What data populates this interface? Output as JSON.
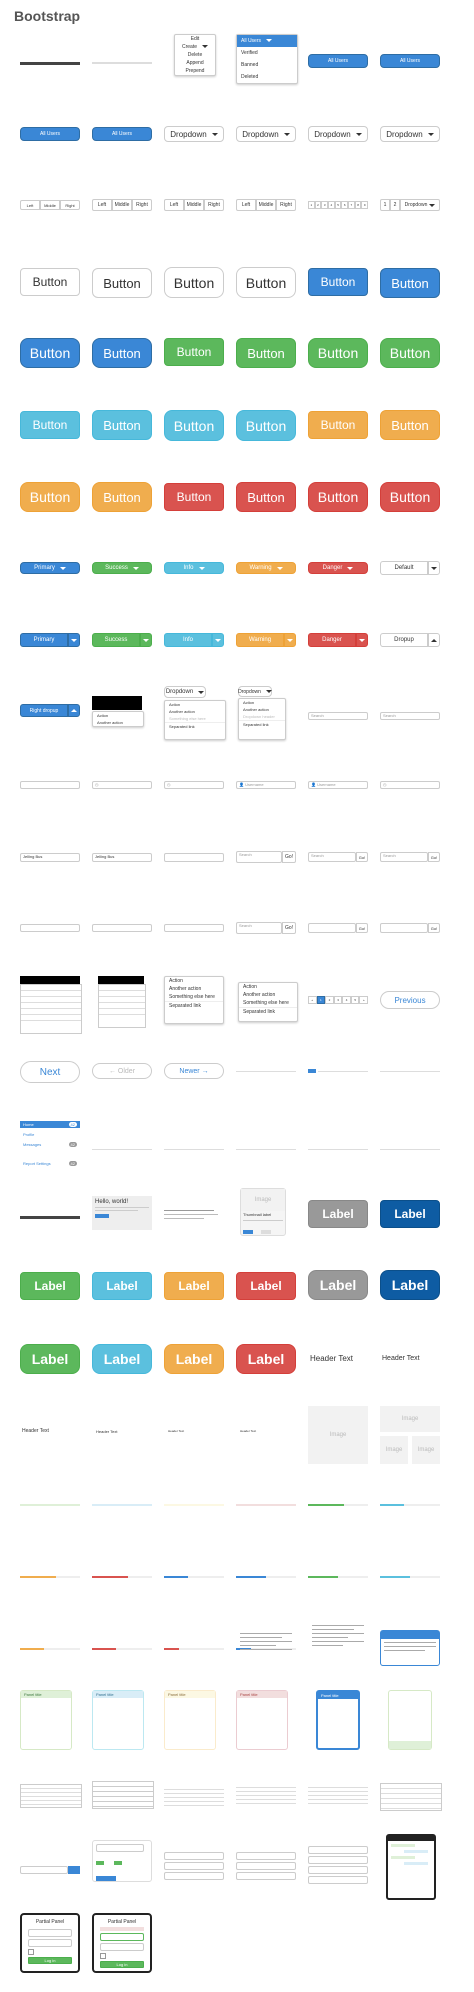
{
  "page_title": "Bootstrap",
  "row2": {
    "menu_items": [
      "Edit",
      "Create",
      "Delete",
      "Append",
      "Prepend"
    ],
    "select_items": [
      "All Users",
      "Verified",
      "Banned",
      "Deleted"
    ],
    "all_users": "All Users"
  },
  "row3": {
    "all_users": "All Users",
    "dropdown": "Dropdown"
  },
  "row4": {
    "left": "Left",
    "middle": "Middle",
    "right": "Right",
    "pager": [
      "1",
      "2",
      "3",
      "4",
      "5",
      "6",
      "7",
      "8",
      "9"
    ],
    "page1": "1",
    "page2": "2",
    "dropdown": "Dropdown"
  },
  "button": "Button",
  "split_labels": {
    "primary": "Primary",
    "success": "Success",
    "info": "Info",
    "warning": "Warning",
    "danger": "Danger",
    "default": "Default",
    "dropup": "Dropup"
  },
  "dropdown_row": {
    "right_dropup": "Right dropup",
    "action": "Action",
    "another_action": "Another action",
    "something_else": "Something else here",
    "separated_link": "Separated link",
    "dropdown": "Dropdown",
    "header": "Dropdown header"
  },
  "inputs": {
    "addon": "@",
    "go": "Go!",
    "search": "Search",
    "username": "Username"
  },
  "row_lists": {
    "separated": "Separated link"
  },
  "pager": {
    "previous": "Previous",
    "next": "Next",
    "older": "Older",
    "newer": "Newer"
  },
  "nav": {
    "items": [
      "Home",
      "Profile",
      "Messages"
    ],
    "badge": "42",
    "more": "Report Settings"
  },
  "jumbotron": {
    "title": "Hello, world!",
    "thumb": "Thumbnail label",
    "image": "Image"
  },
  "label": "Label",
  "header_text": "Header Text",
  "image": "Image",
  "panel": {
    "title": "Panel title"
  },
  "login": {
    "title": "Partial Panel",
    "btn": "Log in"
  }
}
